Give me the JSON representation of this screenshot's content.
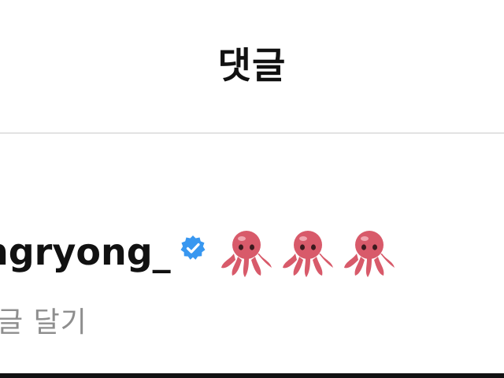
{
  "header": {
    "title": "댓글"
  },
  "comment": {
    "username": "ngryong_",
    "verified_icon": "verified-badge-icon",
    "emoji": [
      "octopus-emoji",
      "octopus-emoji",
      "octopus-emoji"
    ],
    "reply_label": "글 달기"
  },
  "colors": {
    "verified": "#3897f0",
    "secondary_text": "#8e8e8e",
    "divider": "#e3e3e3",
    "octopus": "#d85a6a"
  }
}
